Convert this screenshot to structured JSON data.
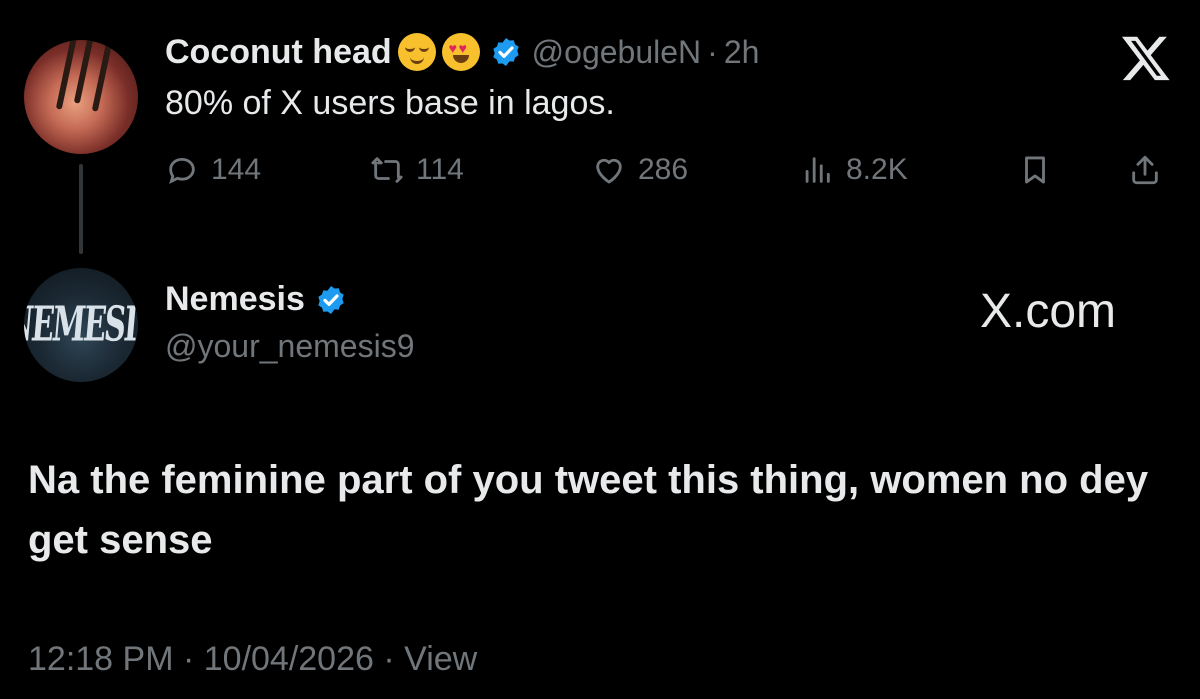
{
  "parent_tweet": {
    "display_name": "Coconut head",
    "emojis": [
      "relieved-face-emoji",
      "heart-eyes-emoji"
    ],
    "handle": "@ogebuleN",
    "separator": "·",
    "time": "2h",
    "text": "80% of X users base in lagos.",
    "actions": {
      "replies": "144",
      "reposts": "114",
      "likes": "286",
      "views": "8.2K"
    }
  },
  "reply_tweet": {
    "display_name": "Nemesis",
    "avatar_text": "NEMESIS",
    "handle": "@your_nemesis9",
    "brand": "X.com",
    "text": "Na the feminine part of you tweet this thing, women no dey get sense",
    "footer": "12:18 PM · 10/04/2026 · View"
  },
  "colors": {
    "background": "#000000",
    "text_primary": "#e7e9ea",
    "text_secondary": "#71767b",
    "verified_blue": "#1d9bf0",
    "thread_line": "#333639"
  },
  "icons": [
    "x-logo-icon",
    "verified-badge-icon",
    "reply-icon",
    "repost-icon",
    "like-icon",
    "views-icon",
    "bookmark-icon",
    "share-icon"
  ]
}
